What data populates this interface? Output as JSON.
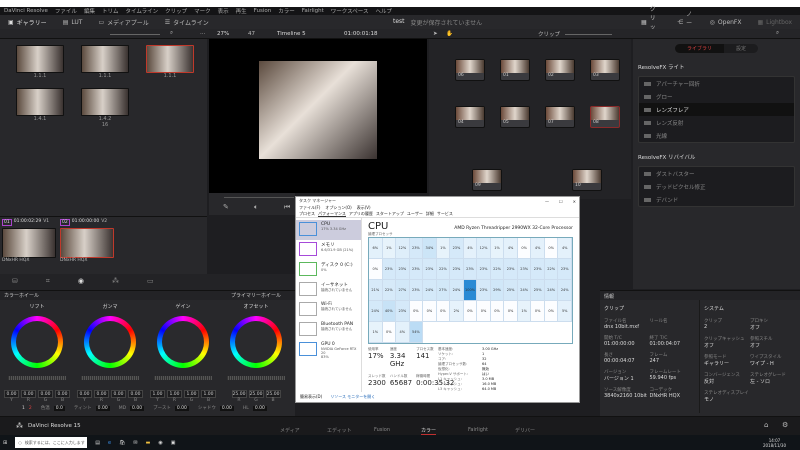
{
  "window": {
    "title": "DaVinci Resolve"
  },
  "menu": [
    "DaVinci Resolve",
    "ファイル",
    "編集",
    "トリム",
    "タイムライン",
    "クリップ",
    "マーク",
    "表示",
    "再生",
    "Fusion",
    "カラー",
    "Fairlight",
    "ワークスペース",
    "ヘルプ"
  ],
  "toolbar": {
    "gallery": "ギャラリー",
    "lut": "LUT",
    "media_pool": "メディアプール",
    "timeline": "タイムライン",
    "project": "test",
    "unsaved": "変更が保存されていません",
    "clip": "クリップ",
    "node": "ノード",
    "openfx": "OpenFX",
    "lightbox": "Lightbox"
  },
  "viewer": {
    "zoom": "27%",
    "frame": "47",
    "timeline_name": "Timeline 5",
    "timecode": "01:00:01:18",
    "node_mode": "クリップ"
  },
  "gallery": [
    {
      "label": "1.1.1"
    },
    {
      "label": "1.1.1"
    },
    {
      "label": "1.1.1"
    },
    {
      "label": "1.4.1"
    },
    {
      "label": "1.4.2",
      "sub": "16"
    }
  ],
  "clips": [
    {
      "num": "01",
      "tc": "01:00:02:29",
      "track": "V1",
      "codec": "DNxHR HQX"
    },
    {
      "num": "02",
      "tc": "01:00:00:00",
      "track": "V2",
      "codec": "DNxHR HQX"
    }
  ],
  "nodes": [
    "06",
    "01",
    "02",
    "03",
    "04",
    "05",
    "07",
    "08",
    "09",
    "10"
  ],
  "right_panel": {
    "tabs": [
      "ライブラリ",
      "設定"
    ],
    "sections": [
      {
        "title": "ResolveFX ライト",
        "items": [
          "アパーチャー回折",
          "グロー",
          "レンズフレア",
          "レンズ反射",
          "光線"
        ],
        "selected": 2
      },
      {
        "title": "ResolveFX リバイバル",
        "items": [
          "ダストバスター",
          "デッドピクセル修正",
          "デバンド"
        ]
      }
    ]
  },
  "color_wheels": {
    "title": "カラーホイール",
    "mode": "プライマリーホイール",
    "wheels": [
      {
        "name": "リフト",
        "values": [
          "0.00",
          "0.00",
          "0.00",
          "0.00"
        ],
        "labels": [
          "Y",
          "R",
          "G",
          "B"
        ]
      },
      {
        "name": "ガンマ",
        "values": [
          "0.00",
          "0.00",
          "0.00",
          "0.00"
        ],
        "labels": [
          "Y",
          "R",
          "G",
          "B"
        ]
      },
      {
        "name": "ゲイン",
        "values": [
          "1.00",
          "1.00",
          "1.00",
          "1.00"
        ],
        "labels": [
          "Y",
          "R",
          "G",
          "B"
        ]
      },
      {
        "name": "オフセット",
        "values": [
          "25.00",
          "25.00",
          "25.00"
        ],
        "labels": [
          "R",
          "G",
          "B"
        ]
      }
    ],
    "bottom": [
      {
        "k": "色温",
        "v": "0.0"
      },
      {
        "k": "ティント",
        "v": "0.00"
      },
      {
        "k": "MD",
        "v": "0.00"
      },
      {
        "k": "ブースト",
        "v": "0.00"
      },
      {
        "k": "シャドウ",
        "v": "0.00"
      },
      {
        "k": "HL",
        "v": "0.00"
      }
    ],
    "page1": "1",
    "page2": "2"
  },
  "info": {
    "title": "情報",
    "clip_title": "クリップ",
    "system_title": "システム",
    "clip": [
      {
        "k": "ファイル名",
        "v": "dnx 10bit.mxf"
      },
      {
        "k": "リール名",
        "v": ""
      },
      {
        "k": "開始 T/C",
        "v": "01:00:00:00"
      },
      {
        "k": "終了 T/C",
        "v": "01:00:04:07"
      },
      {
        "k": "長さ",
        "v": "00:00:04:07"
      },
      {
        "k": "フレーム",
        "v": "247"
      },
      {
        "k": "バージョン",
        "v": "バージョン 1"
      },
      {
        "k": "フレームレート",
        "v": "59.940 fps"
      },
      {
        "k": "ソース解像度",
        "v": "3840x2160 10bit"
      },
      {
        "k": "コーデック",
        "v": "DNxHR HQX"
      }
    ],
    "system": [
      {
        "k": "クリップ",
        "v": "2"
      },
      {
        "k": "プロキシ",
        "v": "オフ"
      },
      {
        "k": "クリップキャッシュ",
        "v": "オフ"
      },
      {
        "k": "参照スチル",
        "v": "オフ"
      },
      {
        "k": "参照モード",
        "v": "ギャラリー"
      },
      {
        "k": "ワイプスタイル",
        "v": "ワイプ - H"
      },
      {
        "k": "コンバージェンス",
        "v": "反対"
      },
      {
        "k": "ステレオグレード",
        "v": "左 - ソロ"
      },
      {
        "k": "ステレオディスプレイ",
        "v": "モノ"
      },
      {
        "k": "",
        "v": ""
      }
    ]
  },
  "pages": {
    "app": "DaVinci Resolve 15",
    "items": [
      "メディア",
      "エディット",
      "Fusion",
      "カラー",
      "Fairlight",
      "デリバー"
    ],
    "active": 3
  },
  "taskmgr": {
    "title": "タスク マネージャー",
    "menu": [
      "ファイル(F)",
      "オプション(O)",
      "表示(V)"
    ],
    "tabs": [
      "プロセス",
      "パフォーマンス",
      "アプリの履歴",
      "スタートアップ",
      "ユーザー",
      "詳細",
      "サービス"
    ],
    "side": [
      {
        "name": "CPU",
        "sub": "17% 3.34 GHz",
        "color": "#4a90d9"
      },
      {
        "name": "メモリ",
        "sub": "6.6/31.9 GB (21%)",
        "color": "#a64ad9"
      },
      {
        "name": "ディスク 0 (C:)",
        "sub": "0%",
        "color": "#5cb85c"
      },
      {
        "name": "イーサネット",
        "sub": "接続されていません",
        "color": "#aaa"
      },
      {
        "name": "Wi-Fi",
        "sub": "接続されていません",
        "color": "#aaa"
      },
      {
        "name": "Bluetooth PAN",
        "sub": "接続されていません",
        "color": "#aaa"
      },
      {
        "name": "GPU 0",
        "sub": "NVIDIA GeForce RTX 20",
        "sub2": "83%",
        "color": "#4a90d9"
      }
    ],
    "heading": "CPU",
    "processor": "AMD Ryzen Threadripper 2990WX 32-Core Processor",
    "grid_label": "論理プロセッサ",
    "cores": [
      6,
      1,
      12,
      23,
      34,
      1,
      23,
      4,
      12,
      1,
      4,
      0,
      4,
      0,
      4,
      0,
      23,
      23,
      23,
      23,
      22,
      23,
      23,
      23,
      22,
      23,
      23,
      23,
      22,
      23,
      21,
      22,
      27,
      23,
      24,
      27,
      24,
      100,
      23,
      29,
      25,
      24,
      25,
      24,
      24,
      24,
      40,
      23,
      0,
      0,
      0,
      2,
      0,
      0,
      0,
      0,
      1,
      0,
      0,
      5,
      1,
      0,
      4,
      54
    ],
    "stats": [
      {
        "k": "使用率",
        "v": "17%"
      },
      {
        "k": "速度",
        "v": "3.34 GHz"
      },
      {
        "k": "プロセス数",
        "v": "141"
      },
      {
        "k": "スレッド数",
        "v": "2300"
      },
      {
        "k": "ハンドル数",
        "v": "65687"
      },
      {
        "k": "稼働時間",
        "v": "0:00:35:32"
      }
    ],
    "details": [
      {
        "k": "基本速度:",
        "v": "3.00 GHz"
      },
      {
        "k": "ソケット:",
        "v": "1"
      },
      {
        "k": "コア:",
        "v": "32"
      },
      {
        "k": "論理プロセッサ数:",
        "v": "64"
      },
      {
        "k": "仮想化:",
        "v": "無効"
      },
      {
        "k": "Hyper-V サポート:",
        "v": "はい"
      },
      {
        "k": "L1 キャッシュ:",
        "v": "3.0 MB"
      },
      {
        "k": "L2 キャッシュ:",
        "v": "16.0 MB"
      },
      {
        "k": "L3 キャッシュ:",
        "v": "64.0 MB"
      }
    ],
    "footer_less": "簡易表示(D)",
    "footer_link": "リソース モニターを開く"
  },
  "taskbar": {
    "search": "検索するには、ここに入力します",
    "time": "14:07",
    "date": "2018/11/30"
  }
}
